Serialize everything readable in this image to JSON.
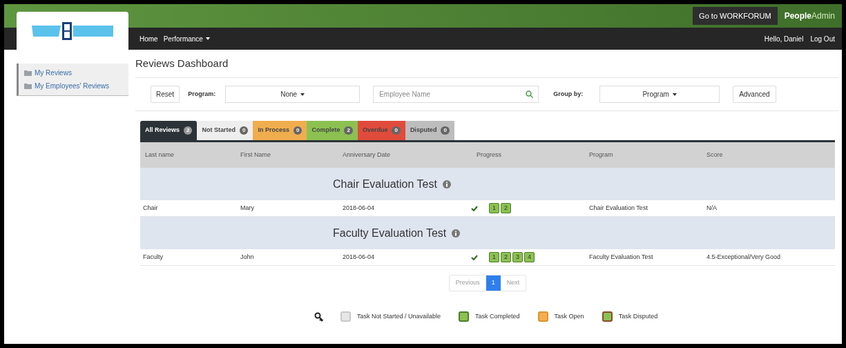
{
  "header": {
    "workforum_button": "Go to WORKFORUM",
    "brand_bold": "People",
    "brand_light": "Admin"
  },
  "nav": {
    "items": [
      {
        "label": "Home",
        "dropdown": false
      },
      {
        "label": "Performance",
        "dropdown": true
      }
    ],
    "greeting": "Hello, Daniel",
    "logout": "Log Out"
  },
  "sidebar": {
    "items": [
      {
        "label": "My Reviews"
      },
      {
        "label": "My Employees' Reviews"
      }
    ]
  },
  "page_title": "Reviews Dashboard",
  "filters": {
    "reset": "Reset",
    "program_label": "Program:",
    "program_value": "None",
    "search_placeholder": "Employee Name",
    "group_label": "Group by:",
    "group_value": "Program",
    "advanced": "Advanced"
  },
  "tabs": [
    {
      "label": "All Reviews",
      "count": "2",
      "color": "#2b3338",
      "selected": true
    },
    {
      "label": "Not Started",
      "count": "0",
      "color": "#eeeeee",
      "selected": false
    },
    {
      "label": "In Process",
      "count": "0",
      "color": "#f0ad4e",
      "selected": false
    },
    {
      "label": "Complete",
      "count": "2",
      "color": "#8cc152",
      "selected": false
    },
    {
      "label": "Overdue",
      "count": "0",
      "color": "#e04b3c",
      "selected": false
    },
    {
      "label": "Disputed",
      "count": "0",
      "color": "#bdbdbd",
      "selected": false
    }
  ],
  "table": {
    "columns": [
      "Last name",
      "First Name",
      "Anniversary Date",
      "Progress",
      "Program",
      "Score"
    ],
    "groups": [
      {
        "title": "Chair Evaluation Test",
        "rows": [
          {
            "last_name": "Chair",
            "first_name": "Mary",
            "date": "2018-06-04",
            "done": true,
            "tasks": [
              {
                "label": "1",
                "kind": "completed"
              },
              {
                "label": "2",
                "kind": "completed"
              }
            ],
            "program": "Chair Evaluation Test",
            "score": "N/A"
          }
        ]
      },
      {
        "title": "Faculty Evaluation Test",
        "rows": [
          {
            "last_name": "Faculty",
            "first_name": "John",
            "date": "2018-06-04",
            "done": true,
            "tasks": [
              {
                "label": "1",
                "kind": "completed"
              },
              {
                "label": "2",
                "kind": "completed"
              },
              {
                "label": "3",
                "kind": "completed"
              },
              {
                "label": "4",
                "kind": "completed"
              }
            ],
            "program": "Faculty Evaluation Test",
            "score": "4.5-Exceptional/Very Good"
          }
        ]
      }
    ]
  },
  "pagination": {
    "previous": "Previous",
    "pages": [
      {
        "label": "1",
        "selected": true
      }
    ],
    "next": "Next"
  },
  "legend": [
    {
      "label": "Task Not Started / Unavailable",
      "kind": "not_started"
    },
    {
      "label": "Task Completed",
      "kind": "completed"
    },
    {
      "label": "Task Open",
      "kind": "open"
    },
    {
      "label": "Task Disputed",
      "kind": "disputed"
    }
  ]
}
